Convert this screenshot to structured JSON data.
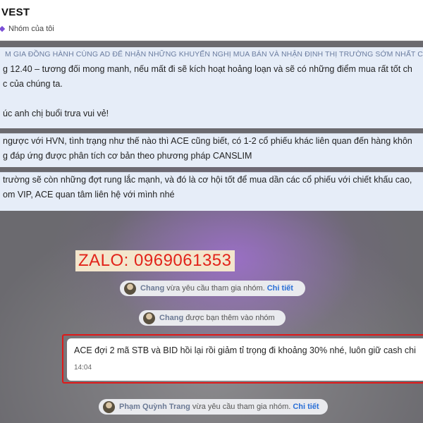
{
  "header": {
    "title": "VEST",
    "subtitle": "Nhóm của tôi"
  },
  "messages": {
    "pinned_caption": "M GIA ĐỒNG HÀNH CÙNG AD ĐỂ NHẬN NHỮNG KHUYẾN NGHỊ MUA BÁN VÀ NHẬN ĐỊNH THỊ TRƯỜNG SỚM NHẤT CÓ TH",
    "line1": "g 12.40 – tương đối mong manh, nếu mất đi sẽ kích hoạt hoảng loạn và sẽ có những điểm mua rất tốt ch",
    "line2": "c của chúng ta.",
    "line3": "úc anh chị buổi trưa vui vẻ!",
    "msg2_line1": " ngược với HVN, tình trạng như thế nào thì ACE cũng biết, có 1-2 cổ phiếu khác liên quan đến hàng khôn",
    "msg2_line2": "g đáp ứng được phân tích cơ bản theo phương pháp CANSLIM",
    "msg3_line1": "trường sẽ còn những đợt rung lắc mạnh, và đó là cơ hội tốt để mua dần các cổ phiếu với chiết khấu cao,",
    "msg3_line2": "om VIP, ACE quan tâm liên hệ với mình nhé"
  },
  "overlay": {
    "zalo_text": "ZALO: 0969061353"
  },
  "system": {
    "notice1": {
      "name": "Chang",
      "text": "vừa yêu cầu tham gia nhóm.",
      "link": "Chi tiết"
    },
    "notice2": {
      "name": "Chang",
      "text": "được bạn thêm vào nhóm"
    },
    "notice3": {
      "name": "Phạm Quỳnh Trang",
      "text": "vừa yêu cầu tham gia nhóm.",
      "link": "Chi tiết"
    }
  },
  "highlight_message": {
    "text": "ACE đợi 2 mã STB và BID hồi lại rồi giảm tỉ trọng đi khoảng 30% nhé, luôn giữ cash chi",
    "time": "14:04"
  },
  "colors": {
    "accent_link": "#2a6fd6",
    "highlight_border": "#e01919",
    "zalo_text": "#e2231a"
  }
}
